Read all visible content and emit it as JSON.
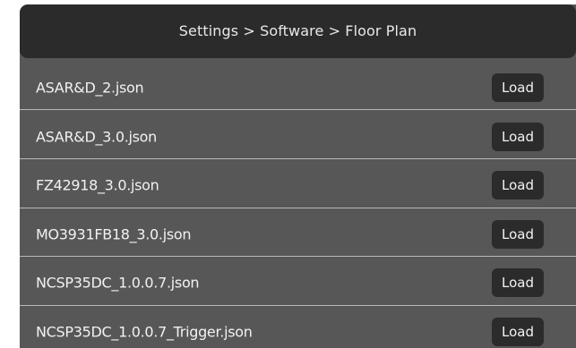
{
  "header": {
    "breadcrumb": "Settings > Software > Floor Plan"
  },
  "files": [
    {
      "name": "ASAR&D_2.json",
      "action": "Load"
    },
    {
      "name": "ASAR&D_3.0.json",
      "action": "Load"
    },
    {
      "name": "FZ42918_3.0.json",
      "action": "Load"
    },
    {
      "name": "MO3931FB18_3.0.json",
      "action": "Load"
    },
    {
      "name": "NCSP35DC_1.0.0.7.json",
      "action": "Load"
    },
    {
      "name": "NCSP35DC_1.0.0.7_Trigger.json",
      "action": "Load"
    }
  ],
  "colors": {
    "panel_background": "#575757",
    "header_background": "#2b2b2b",
    "button_background": "#2b2b2b",
    "text": "#f2f2f2",
    "divider": "#b9b9b9"
  }
}
